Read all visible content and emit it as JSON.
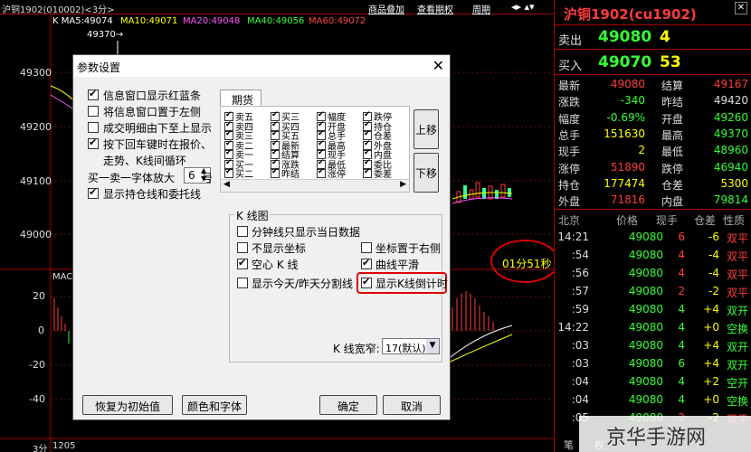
{
  "chart": {
    "title": "沪铜1902(010002)<3分>",
    "links": [
      "商品叠加",
      "查看期权",
      "周期"
    ],
    "ma": [
      {
        "label": "K  MA5:49074",
        "color": "#ffffff"
      },
      {
        "label": "MA10:49071",
        "color": "#ffff00"
      },
      {
        "label": "MA20:49048",
        "color": "#ff55ff"
      },
      {
        "label": "MA40:49056",
        "color": "#33ff33"
      },
      {
        "label": "MA60:49072",
        "color": "#ff4444"
      }
    ],
    "high_mark": "49370→",
    "y_prices": [
      "49300",
      "49200",
      "49100",
      "49000"
    ],
    "y_macd": [
      "20",
      "0",
      "-20",
      "-40"
    ],
    "macd_label": "MAC",
    "bottom_left": "3分",
    "bottom_val": "1205",
    "countdown": "01分51秒"
  },
  "panel": {
    "title": "沪铜1902(cu1902)",
    "sell": {
      "label": "卖出",
      "price": "49080",
      "vol": "4"
    },
    "buy": {
      "label": "买入",
      "price": "49070",
      "vol": "53"
    },
    "quotes": [
      {
        "l1": "最新",
        "v1": "49080",
        "c1": "#ff3b3b",
        "l2": "结算",
        "v2": "49167",
        "c2": "#ff3b3b"
      },
      {
        "l1": "涨跌",
        "v1": "-340",
        "c1": "#33ff33",
        "l2": "昨结",
        "v2": "49420",
        "c2": "#dddddd"
      },
      {
        "l1": "幅度",
        "v1": "-0.69%",
        "c1": "#33ff33",
        "l2": "开盘",
        "v2": "49260",
        "c2": "#33ff33"
      },
      {
        "l1": "总手",
        "v1": "151630",
        "c1": "#ffff00",
        "l2": "最高",
        "v2": "49370",
        "c2": "#33ff33"
      },
      {
        "l1": "现手",
        "v1": "2",
        "c1": "#ffff00",
        "l2": "最低",
        "v2": "48960",
        "c2": "#33ff33"
      },
      {
        "l1": "涨停",
        "v1": "51890",
        "c1": "#ff3b3b",
        "l2": "跌停",
        "v2": "46940",
        "c2": "#33ff33"
      },
      {
        "l1": "持仓",
        "v1": "177474",
        "c1": "#ffff00",
        "l2": "仓差",
        "v2": "5300",
        "c2": "#ffff00"
      },
      {
        "l1": "外盘",
        "v1": "71816",
        "c1": "#ff3b3b",
        "l2": "内盘",
        "v2": "79814",
        "c2": "#33ff33"
      }
    ],
    "tick_headers": [
      "北京",
      "价格",
      "现手",
      "仓差",
      "性质"
    ],
    "ticks": [
      {
        "t": "14:21",
        "p": "49080",
        "v": "6",
        "vc": "#ff3b3b",
        "d": "-6",
        "dc": "#ffff00",
        "n": "双平",
        "nc": "#ff3b3b"
      },
      {
        "t": ":54",
        "p": "49080",
        "v": "4",
        "vc": "#ff3b3b",
        "d": "-4",
        "dc": "#ffff00",
        "n": "双平",
        "nc": "#ff3b3b"
      },
      {
        "t": ":56",
        "p": "49080",
        "v": "4",
        "vc": "#ff3b3b",
        "d": "-4",
        "dc": "#ffff00",
        "n": "双平",
        "nc": "#ff3b3b"
      },
      {
        "t": ":57",
        "p": "49080",
        "v": "2",
        "vc": "#ff3b3b",
        "d": "-2",
        "dc": "#ffff00",
        "n": "双平",
        "nc": "#ff3b3b"
      },
      {
        "t": ":59",
        "p": "49080",
        "v": "4",
        "vc": "#33ff33",
        "d": "+4",
        "dc": "#ffff00",
        "n": "双开",
        "nc": "#33ff33"
      },
      {
        "t": "14:22",
        "p": "49080",
        "v": "4",
        "vc": "#33ff33",
        "d": "+0",
        "dc": "#ffff00",
        "n": "空换",
        "nc": "#33ff33"
      },
      {
        "t": ":03",
        "p": "49080",
        "v": "4",
        "vc": "#33ff33",
        "d": "+4",
        "dc": "#ffff00",
        "n": "双开",
        "nc": "#33ff33"
      },
      {
        "t": ":03",
        "p": "49080",
        "v": "6",
        "vc": "#33ff33",
        "d": "+4",
        "dc": "#ffff00",
        "n": "双开",
        "nc": "#33ff33"
      },
      {
        "t": ":04",
        "p": "49080",
        "v": "4",
        "vc": "#33ff33",
        "d": "+2",
        "dc": "#ffff00",
        "n": "空开",
        "nc": "#33ff33"
      },
      {
        "t": ":04",
        "p": "49080",
        "v": "4",
        "vc": "#33ff33",
        "d": "+0",
        "dc": "#ffff00",
        "n": "空换",
        "nc": "#33ff33"
      },
      {
        "t": ":05",
        "p": "49080",
        "v": "2",
        "vc": "#ff3b3b",
        "d": "-2",
        "dc": "#ffff00",
        "n": "双平",
        "nc": "#ff3b3b"
      }
    ],
    "bottom_tabs": [
      "笔",
      "权"
    ]
  },
  "dialog": {
    "title": "参数设置",
    "options": [
      {
        "label": "信息窗口显示红蓝条",
        "on": true
      },
      {
        "label": "将信息窗口置于左侧",
        "on": false
      },
      {
        "label": "成交明细由下至上显示",
        "on": false
      },
      {
        "label": "按下回车键时在报价、",
        "on": true
      }
    ],
    "option4_line2": "走势、K线间循环",
    "zoom_label": "买一卖一字体放大",
    "zoom_value": "6",
    "zoom_unit": "号",
    "show_position": "显示持仓线和委托线",
    "futures_tab": "期货",
    "futures_cols": [
      [
        "卖五",
        "卖四",
        "卖三",
        "卖二",
        "卖一",
        "买一",
        "买二"
      ],
      [
        "买三",
        "买四",
        "买五",
        "最新",
        "结算",
        "涨跌",
        "昨结"
      ],
      [
        "幅度",
        "开盘",
        "总手",
        "最高",
        "现手",
        "最低",
        "涨停"
      ],
      [
        "跌停",
        "持仓",
        "仓差",
        "外盘",
        "内盘",
        "委比",
        "委差"
      ]
    ],
    "move_up": "上移",
    "move_down": "下移",
    "kline_group": "K 线图",
    "kline_opts": [
      {
        "label": "分钟线只显示当日数据",
        "on": false
      },
      {
        "label": "不显示坐标",
        "on": false
      },
      {
        "label": "坐标置于右侧",
        "on": false
      },
      {
        "label": "空心 K 线",
        "on": true
      },
      {
        "label": "曲线平滑",
        "on": true
      },
      {
        "label": "显示今天/昨天分割线",
        "on": false
      },
      {
        "label": "显示K线倒计时",
        "on": true
      }
    ],
    "kwidth_label": "K 线宽窄:",
    "kwidth_value": "17(默认)",
    "btn_reset": "恢复为初始值",
    "btn_color": "颜色和字体",
    "btn_ok": "确定",
    "btn_cancel": "取消"
  },
  "watermark": "京华手游网"
}
